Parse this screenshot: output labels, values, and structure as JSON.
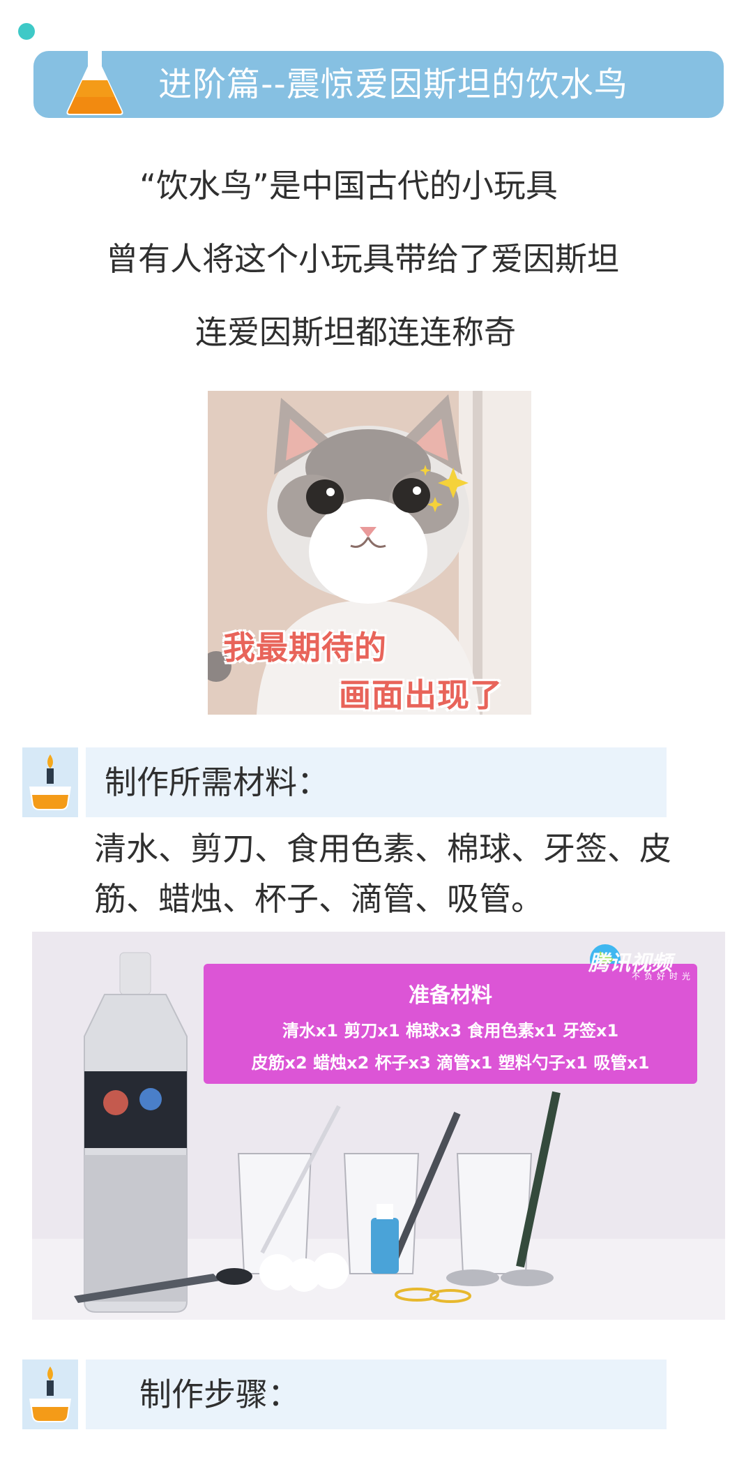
{
  "header": {
    "title": "进阶篇--震惊爱因斯坦的饮水鸟",
    "icon": "flask-icon"
  },
  "intro": {
    "line1": "“饮水鸟”是中国古代的小玩具",
    "line2": "曾有人将这个小玩具带给了爱因斯坦",
    "line3": "连爱因斯坦都连连称奇"
  },
  "meme": {
    "caption_line1": "我最期待的",
    "caption_line2": "画面出现了"
  },
  "materials_section": {
    "label": "制作所需材料：",
    "icon": "candle-icon",
    "text": "清水、剪刀、食用色素、棉球、牙签、皮筋、蜡烛、杯子、滴管、吸管。"
  },
  "materials_photo": {
    "panel_title": "准备材料",
    "panel_line1": "清水x1 剪刀x1 棉球x3 食用色素x1 牙签x1",
    "panel_line2": "皮筋x2 蜡烛x2 杯子x3 滴管x1 塑料勺子x1 吸管x1",
    "watermark": "腾讯视频",
    "watermark_sub": "不负好时光"
  },
  "steps_section": {
    "label": "制作步骤：",
    "icon": "candle-icon"
  },
  "colors": {
    "header_bar": "#86c0e2",
    "section_box": "#eaf3fb",
    "accent_dot": "#3ec9c7",
    "panel": "#dc55d6"
  }
}
